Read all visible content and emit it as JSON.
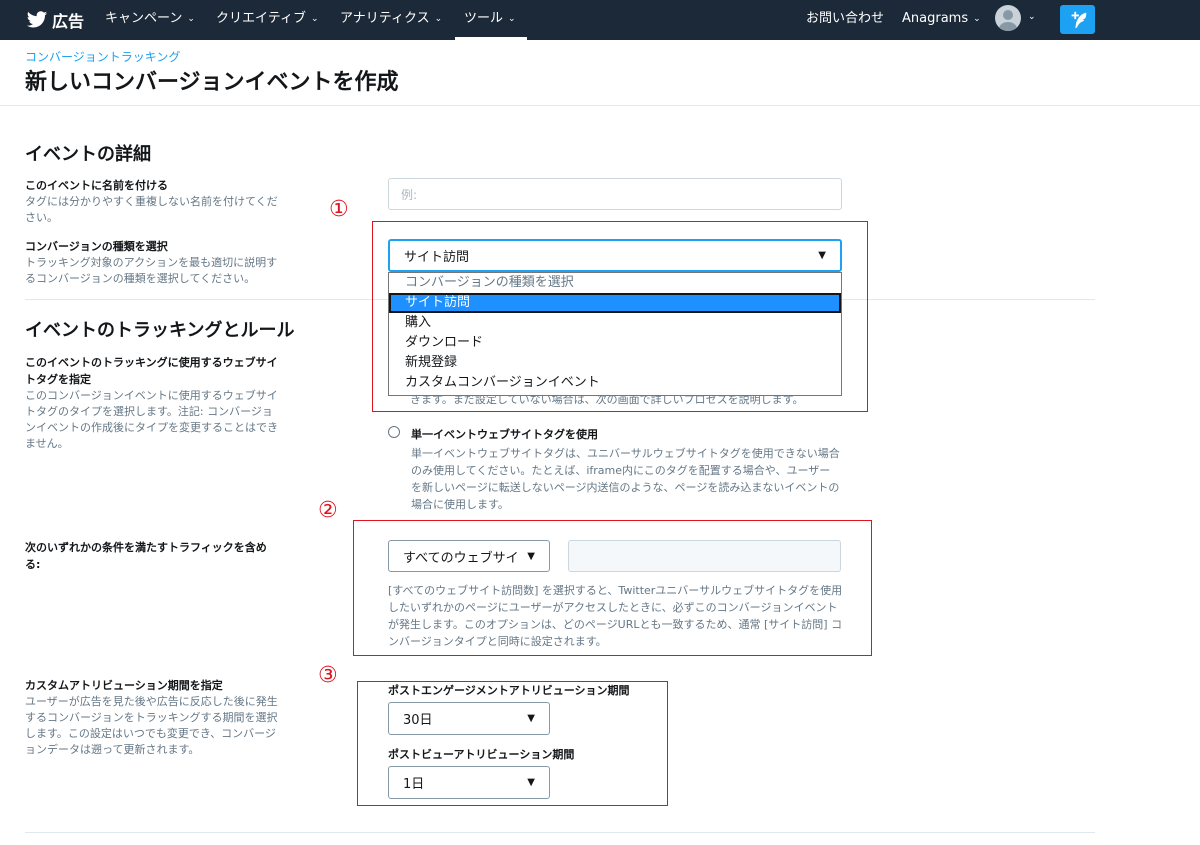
{
  "nav": {
    "brand": "広告",
    "items": [
      {
        "label": "キャンペーン"
      },
      {
        "label": "クリエイティブ"
      },
      {
        "label": "アナリティクス"
      },
      {
        "label": "ツール"
      }
    ],
    "contact": "お問い合わせ",
    "account": "Anagrams"
  },
  "header": {
    "breadcrumb": "コンバージョントラッキング",
    "title": "新しいコンバージョンイベントを作成"
  },
  "details": {
    "section_title": "イベントの詳細",
    "name_label": "このイベントに名前を付ける",
    "name_desc": "タグには分かりやすく重複しない名前を付けてください。",
    "name_placeholder": "例:",
    "type_label": "コンバージョンの種類を選択",
    "type_desc": "トラッキング対象のアクションを最も適切に説明するコンバージョンの種類を選択してください。",
    "type_value": "サイト訪問",
    "type_options": [
      {
        "label": "コンバージョンの種類を選択"
      },
      {
        "label": "サイト訪問"
      },
      {
        "label": "購入"
      },
      {
        "label": "ダウンロード"
      },
      {
        "label": "新規登録"
      },
      {
        "label": "カスタムコンバージョンイベント"
      }
    ]
  },
  "tracking": {
    "section_title": "イベントのトラッキングとルール",
    "tag_label": "このイベントのトラッキングに使用するウェブサイトタグを指定",
    "tag_desc": "このコンバージョンイベントに使用するウェブサイトタグのタイプを選択します。注記: コンバージョンイベントの作成後にタイプを変更することはできません。",
    "hidden_text": "きます。まだ設定していない場合は、次の画面で詳しいプロセスを説明します。",
    "single_tag_label": "単一イベントウェブサイトタグを使用",
    "single_tag_desc": "単一イベントウェブサイトタグは、ユニバーサルウェブサイトタグを使用できない場合のみ使用してください。たとえば、iframe内にこのタグを配置する場合や、ユーザーを新しいページに転送しないページ内送信のような、ページを読み込まないイベントの場合に使用します。",
    "traffic_label": "次のいずれかの条件を満たすトラフィックを含める:",
    "traffic_value": "すべてのウェブサイ",
    "traffic_help": "[すべてのウェブサイト訪問数] を選択すると、Twitterユニバーサルウェブサイトタグを使用したいずれかのページにユーザーがアクセスしたときに、必ずこのコンバージョンイベントが発生します。このオプションは、どのページURLとも一致するため、通常 [サイト訪問] コンバージョンタイプと同時に設定されます。"
  },
  "attribution": {
    "label": "カスタムアトリビューション期間を指定",
    "desc": "ユーザーが広告を見た後や広告に反応した後に発生するコンバージョンをトラッキングする期間を選択します。この設定はいつでも変更でき、コンバージョンデータは遡って更新されます。",
    "engagement_label": "ポストエンゲージメントアトリビューション期間",
    "engagement_value": "30日",
    "view_label": "ポストビューアトリビューション期間",
    "view_value": "1日"
  },
  "annotations": {
    "one": "①",
    "two": "②",
    "three": "③"
  },
  "colors": {
    "nav_bg": "#1c2938",
    "accent": "#1da1f2",
    "annotation_red": "#e0141e",
    "selected_option": "#1e90ff"
  }
}
